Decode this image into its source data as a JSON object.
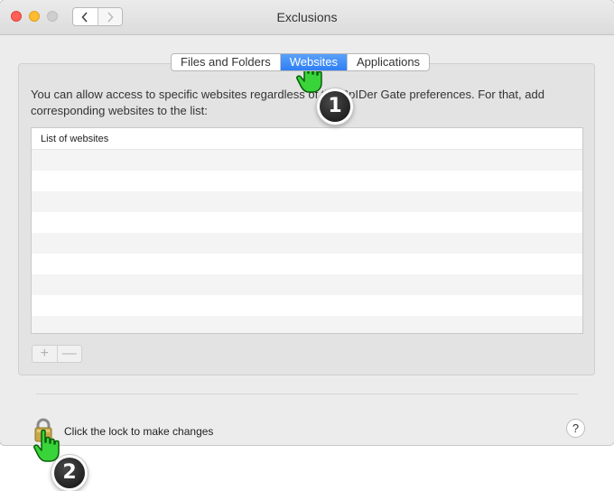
{
  "window": {
    "title": "Exclusions"
  },
  "tabs": [
    {
      "label": "Files and Folders",
      "active": false
    },
    {
      "label": "Websites",
      "active": true
    },
    {
      "label": "Applications",
      "active": false
    }
  ],
  "instructions": "You can allow access to specific websites regardless of the SpIDer Gate preferences. For that, add corresponding websites to the list:",
  "list": {
    "header": "List of websites",
    "rows": []
  },
  "list_controls": {
    "add": "+",
    "remove": "—"
  },
  "footer": {
    "lock_text": "Click the lock to make changes",
    "help": "?"
  },
  "callouts": {
    "step1": "1",
    "step2": "2"
  },
  "colors": {
    "accent": "#2f7ff5",
    "cursor": "#33cc33",
    "badge": "#1a1a1a"
  },
  "icons": [
    "back-chevron-icon",
    "forward-chevron-icon",
    "lock-icon",
    "hand-pointer-cursor-icon",
    "help-icon"
  ]
}
